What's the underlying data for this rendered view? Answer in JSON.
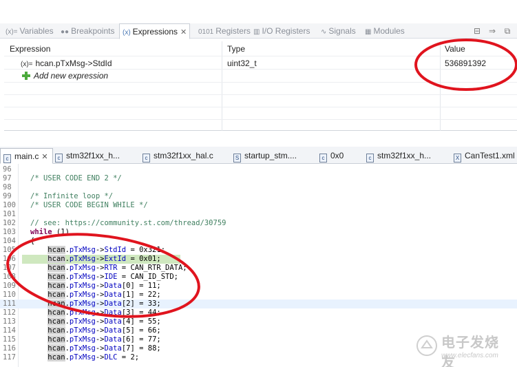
{
  "debug_tabs": [
    {
      "label": "Variables",
      "icon": "variables-icon",
      "active": false
    },
    {
      "label": "Breakpoints",
      "icon": "breakpoints-icon",
      "active": false
    },
    {
      "label": "Expressions",
      "icon": "expressions-icon",
      "active": true
    },
    {
      "label": "Registers",
      "icon": "registers-icon",
      "active": false
    },
    {
      "label": "I/O Registers",
      "icon": "io-registers-icon",
      "active": false
    },
    {
      "label": "Signals",
      "icon": "signals-icon",
      "active": false
    },
    {
      "label": "Modules",
      "icon": "modules-icon",
      "active": false
    }
  ],
  "expressions": {
    "headers": {
      "expression": "Expression",
      "type": "Type",
      "value": "Value"
    },
    "rows": [
      {
        "expression": "hcan.pTxMsg->StdId",
        "type": "uint32_t",
        "value": "536891392"
      }
    ],
    "add_label": "Add new expression"
  },
  "editor_tabs": [
    {
      "label": "main.c",
      "icon_letter": "c",
      "active": true
    },
    {
      "label": "stm32f1xx_h...",
      "icon_letter": "c",
      "active": false
    },
    {
      "label": "stm32f1xx_hal.c",
      "icon_letter": "c",
      "active": false
    },
    {
      "label": "startup_stm....",
      "icon_letter": "S",
      "active": false
    },
    {
      "label": "0x0",
      "icon_letter": "c",
      "active": false
    },
    {
      "label": "stm32f1xx_h...",
      "icon_letter": "c",
      "active": false
    },
    {
      "label": "CanTest1.xml",
      "icon_letter": "X",
      "active": false
    }
  ],
  "code_lines": [
    {
      "num": "96",
      "text": ""
    },
    {
      "num": "97",
      "text": "/* USER CODE END 2 */"
    },
    {
      "num": "98",
      "text": ""
    },
    {
      "num": "99",
      "text": "/* Infinite loop */"
    },
    {
      "num": "100",
      "text": "/* USER CODE BEGIN WHILE */"
    },
    {
      "num": "101",
      "text": ""
    },
    {
      "num": "102",
      "text": "// see: https://community.st.com/thread/30759"
    },
    {
      "num": "103",
      "text": "while (1)"
    },
    {
      "num": "104",
      "text": "{"
    },
    {
      "num": "105",
      "text": "    hcan.pTxMsg->StdId = 0x321;"
    },
    {
      "num": "106",
      "text": "    hcan.pTxMsg->ExtId = 0x01;"
    },
    {
      "num": "107",
      "text": "    hcan.pTxMsg->RTR = CAN_RTR_DATA;"
    },
    {
      "num": "108",
      "text": "    hcan.pTxMsg->IDE = CAN_ID_STD;"
    },
    {
      "num": "109",
      "text": "    hcan.pTxMsg->Data[0] = 11;"
    },
    {
      "num": "110",
      "text": "    hcan.pTxMsg->Data[1] = 22;"
    },
    {
      "num": "111",
      "text": "    hcan.pTxMsg->Data[2] = 33;"
    },
    {
      "num": "112",
      "text": "    hcan.pTxMsg->Data[3] = 44;"
    },
    {
      "num": "113",
      "text": "    hcan.pTxMsg->Data[4] = 55;"
    },
    {
      "num": "114",
      "text": "    hcan.pTxMsg->Data[5] = 66;"
    },
    {
      "num": "115",
      "text": "    hcan.pTxMsg->Data[6] = 77;"
    },
    {
      "num": "116",
      "text": "    hcan.pTxMsg->Data[7] = 88;"
    },
    {
      "num": "117",
      "text": "    hcan.pTxMsg->DLC = 2;"
    }
  ],
  "highlighted_line": "106",
  "current_line": "111",
  "annotation_color": "#e0141e",
  "watermark": {
    "text": "电子发烧友",
    "url": "www.elecfans.com"
  }
}
